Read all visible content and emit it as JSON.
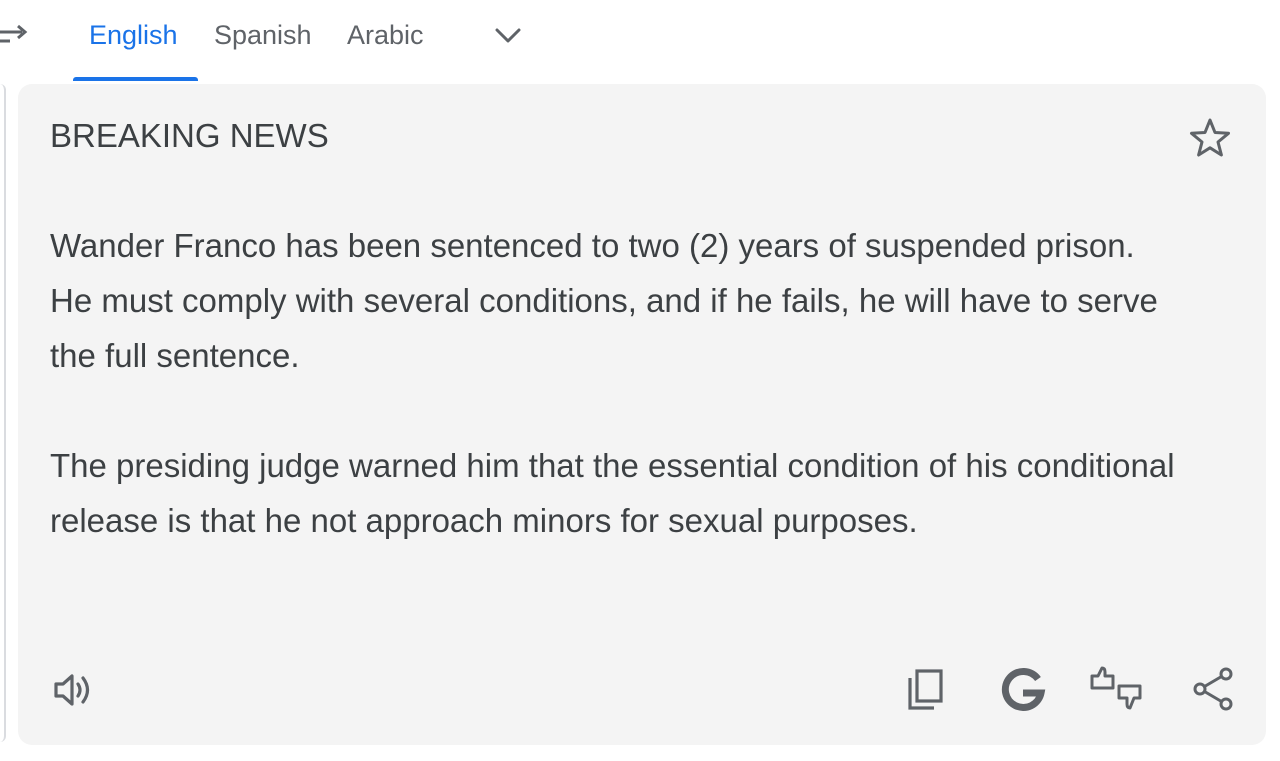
{
  "tabs": {
    "items": [
      {
        "label": "English",
        "active": true
      },
      {
        "label": "Spanish",
        "active": false
      },
      {
        "label": "Arabic",
        "active": false
      }
    ]
  },
  "translation": {
    "heading": "BREAKING NEWS",
    "paragraph1": "Wander Franco has been sentenced to two (2) years of suspended prison. He must comply with several conditions, and if he fails, he will have to serve the full sentence.",
    "paragraph2": "The presiding judge warned him that the essential condition of his conditional release is that he not approach minors for sexual purposes."
  },
  "icons": {
    "swap": "swap-languages-icon",
    "more_languages": "chevron-down-icon",
    "save": "star-icon",
    "listen": "speaker-icon",
    "copy": "copy-icon",
    "search": "google-icon",
    "rate": "thumbs-rating-icon",
    "share": "share-icon"
  },
  "colors": {
    "accent": "#1a73e8",
    "inactive_tab": "#5f6368",
    "card_background": "#f4f4f4",
    "text": "#3c4043",
    "icon": "#5f6368"
  }
}
